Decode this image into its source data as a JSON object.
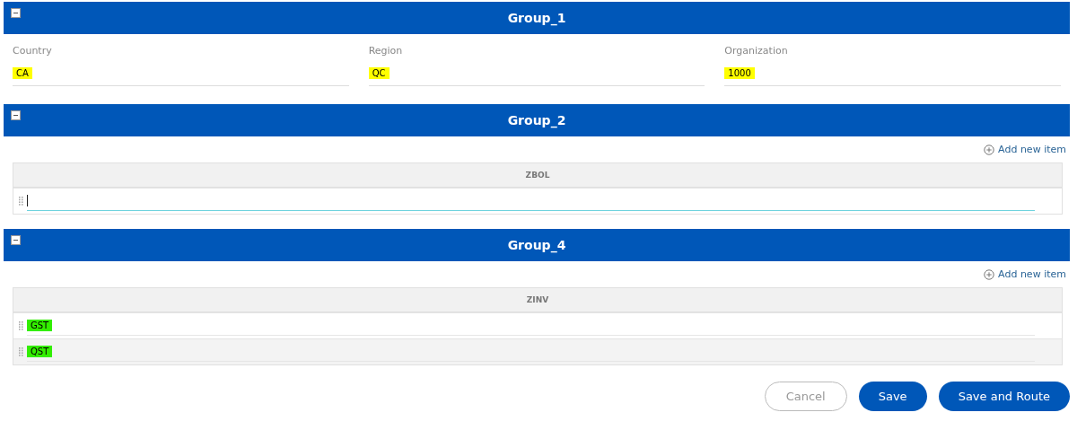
{
  "groups": [
    {
      "kind": "fields",
      "title": "Group_1",
      "expanded": true,
      "fields": [
        {
          "label": "Country",
          "value": "CA",
          "color": "#ffff00"
        },
        {
          "label": "Region",
          "value": "QC",
          "color": "#ffff00"
        },
        {
          "label": "Organization",
          "value": "1000",
          "color": "#ffff00"
        }
      ]
    },
    {
      "kind": "table",
      "title": "Group_2",
      "expanded": true,
      "add_label": "Add new item",
      "column": "ZBOL",
      "rows": [
        {
          "value": "",
          "focused": true
        }
      ]
    },
    {
      "kind": "table",
      "title": "Group_4",
      "expanded": true,
      "add_label": "Add new item",
      "column": "ZINV",
      "rows": [
        {
          "value": "GST",
          "focused": false,
          "color": "#33ee00"
        },
        {
          "value": "QST",
          "focused": false,
          "color": "#33ee00"
        }
      ]
    }
  ],
  "buttons": [
    {
      "label": "Cancel",
      "kind": "secondary"
    },
    {
      "label": "Save",
      "kind": "primary"
    },
    {
      "label": "Save and Route",
      "kind": "primary"
    }
  ]
}
